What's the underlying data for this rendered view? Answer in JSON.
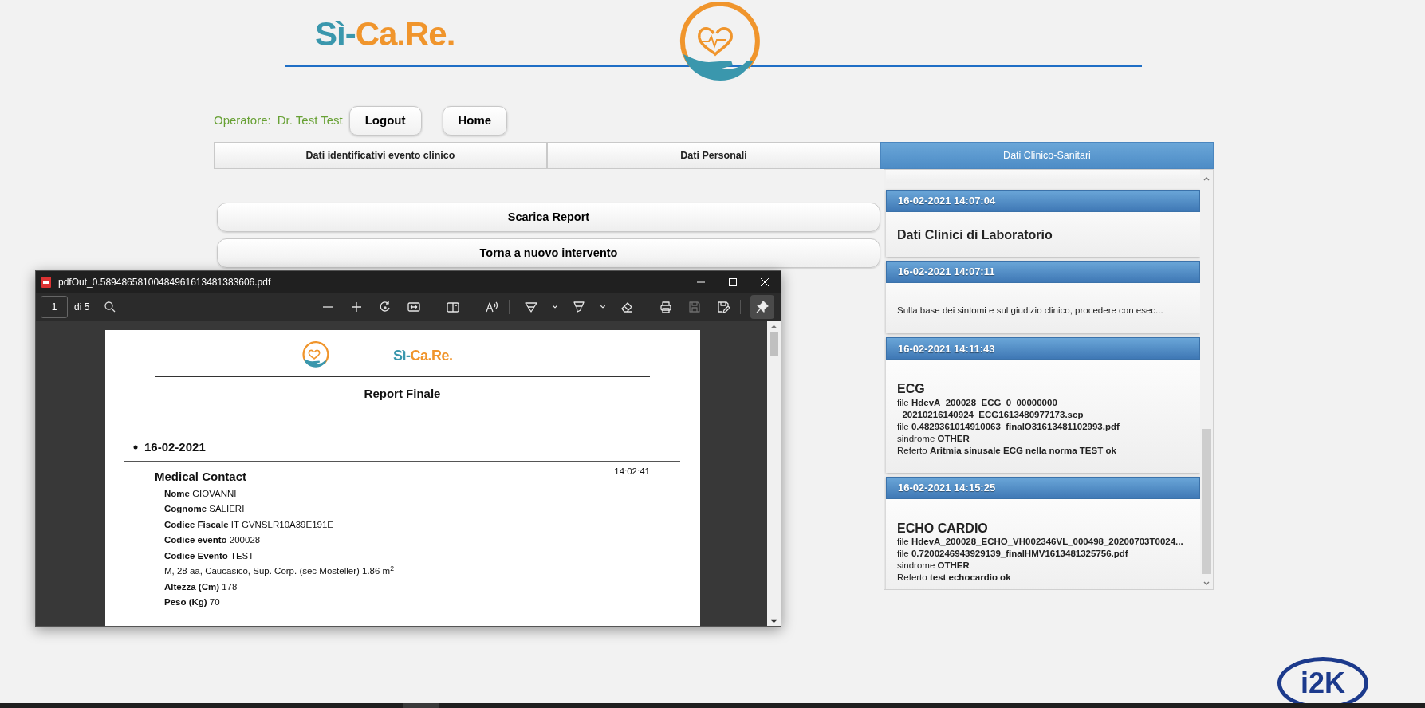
{
  "header": {
    "brand_parts": [
      "Sì-",
      "Ca.Re."
    ]
  },
  "operator": {
    "label": "Operatore:",
    "name": "Dr. Test Test"
  },
  "nav_buttons": [
    "Logout",
    "Home"
  ],
  "tabs": [
    {
      "label": "Dati identificativi evento clinico",
      "selected": false
    },
    {
      "label": "Dati Personali",
      "selected": false
    },
    {
      "label": "Dati Clinico-Sanitari",
      "selected": true
    }
  ],
  "actions": [
    "Scarica Report",
    "Torna a nuovo intervento"
  ],
  "clinical_entries": [
    {
      "timestamp": "16-02-2021 14:07:04",
      "title": "Dati Clinici di Laboratorio"
    },
    {
      "timestamp": "16-02-2021 14:07:11",
      "note": "Sulla base dei sintomi e sul giudizio clinico, procedere con esec..."
    },
    {
      "timestamp": "16-02-2021 14:11:43",
      "title": "ECG",
      "lines": [
        "file **HdevA_200028_ECG_0_00000000_ _20210216140924_ECG1613480977173.scp**",
        "file **0.4829361014910063_finalO31613481102993.pdf**",
        "sindrome **OTHER**",
        "Referto **Aritmia sinusale ECG nella norma TEST ok**"
      ]
    },
    {
      "timestamp": "16-02-2021 14:15:25",
      "title": "ECHO CARDIO",
      "lines": [
        "file **HdevA_200028_ECHO_VH002346VL_000498_20200703T0024...**",
        "file **0.7200246943929139_finalHMV1613481325756.pdf**",
        "sindrome **OTHER**",
        "Referto **test echocardio ok**"
      ]
    }
  ],
  "pdf_viewer": {
    "title": "pdfOut_0.58948658100484961613481383606.pdf",
    "page": "1",
    "page_count": "di 5",
    "tools": [
      {
        "kind": "minus",
        "disabled": false,
        "selected": false
      },
      {
        "kind": "plus",
        "disabled": false,
        "selected": false
      },
      {
        "kind": "rotate",
        "disabled": false,
        "selected": false
      },
      {
        "kind": "fit",
        "disabled": false,
        "selected": false
      },
      {
        "kind": "pageview",
        "disabled": false,
        "selected": false
      },
      {
        "kind": "read",
        "disabled": false,
        "selected": false
      },
      {
        "kind": "draw",
        "disabled": false,
        "selected": false
      },
      {
        "kind": "chevron",
        "disabled": false,
        "selected": false
      },
      {
        "kind": "highlight",
        "disabled": false,
        "selected": false
      },
      {
        "kind": "chevron",
        "disabled": false,
        "selected": false
      },
      {
        "kind": "erase",
        "disabled": false,
        "selected": false
      },
      {
        "kind": "print",
        "disabled": false,
        "selected": false
      },
      {
        "kind": "save",
        "disabled": true,
        "selected": false
      },
      {
        "kind": "saveas",
        "disabled": false,
        "selected": false
      },
      {
        "kind": "pin",
        "disabled": false,
        "selected": true
      }
    ],
    "document": {
      "brand_parts": [
        "Sì-",
        "Ca.Re."
      ],
      "heading": "Report Finale",
      "date": "16-02-2021",
      "time": "14:02:41",
      "section": "Medical Contact",
      "fields": [
        "**Nome** GIOVANNI",
        "**Cognome** SALIERI",
        "**Codice Fiscale** IT GVNSLR10A39E191E",
        "**Codice evento** 200028",
        "**Codice Evento** TEST",
        "M, 28 aa, Caucasico, Sup. Corp. (sec Mosteller) 1.86 m$^{2}$",
        "**Altezza (Cm)** 178",
        "**Peso (Kg)** 70"
      ]
    }
  },
  "footer": {
    "logo_text": "i2K"
  }
}
